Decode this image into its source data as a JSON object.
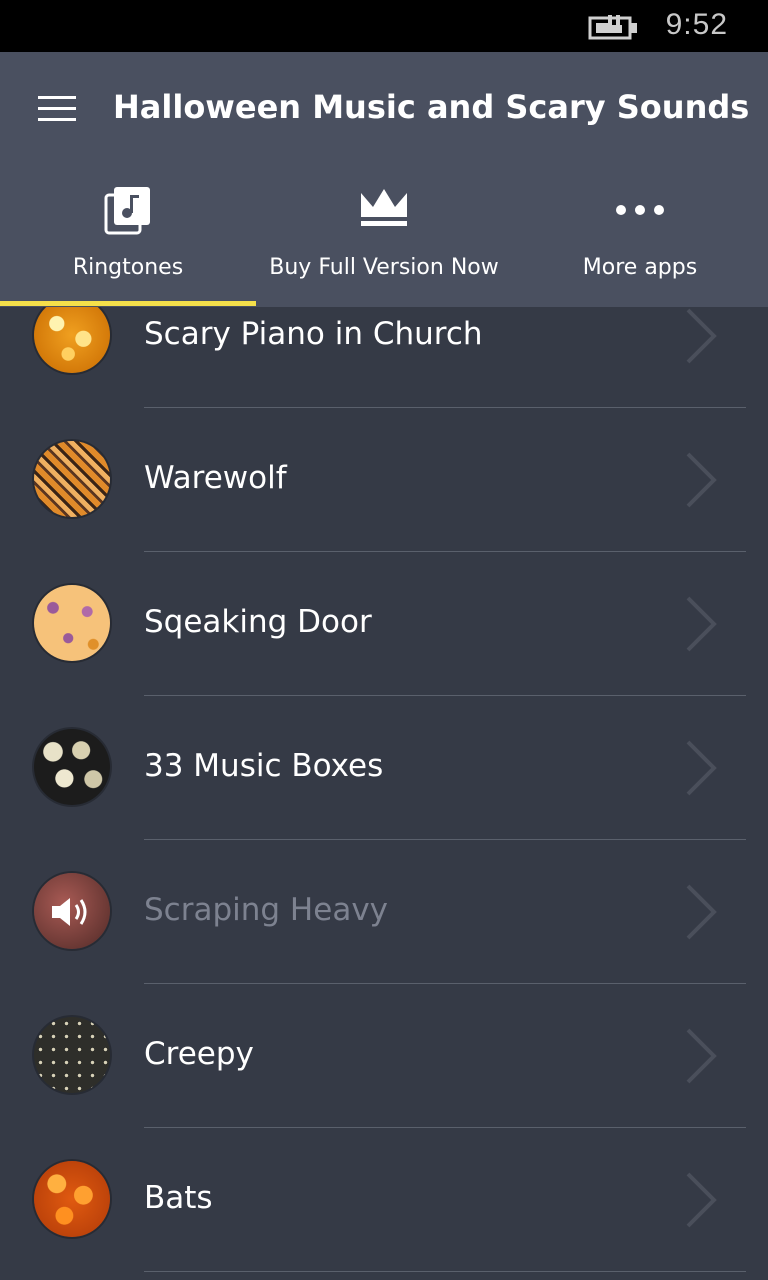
{
  "status": {
    "time": "9:52"
  },
  "header": {
    "title": "Halloween Music and Scary Sounds"
  },
  "tabs": [
    {
      "label": "Ringtones",
      "icon": "music-library-icon",
      "selected": true
    },
    {
      "label": "Buy Full Version Now",
      "icon": "crown-icon",
      "selected": false
    },
    {
      "label": "More apps",
      "icon": "more-dots-icon",
      "selected": false
    }
  ],
  "colors": {
    "accent": "#f5e04a",
    "header": "#4a5060",
    "background": "#353a46"
  },
  "items": [
    {
      "label": "Scary Piano in Church",
      "thumb": "golden-bokeh"
    },
    {
      "label": "Warewolf",
      "thumb": "orange-stripes"
    },
    {
      "label": "Sqeaking Door",
      "thumb": "pumpkin-pattern"
    },
    {
      "label": "33 Music Boxes",
      "thumb": "skull-pile"
    },
    {
      "label": "Scraping Heavy",
      "thumb": "red-texture",
      "playing": true
    },
    {
      "label": "Creepy",
      "thumb": "skull-pattern"
    },
    {
      "label": "Bats",
      "thumb": "orange-flowers"
    }
  ]
}
